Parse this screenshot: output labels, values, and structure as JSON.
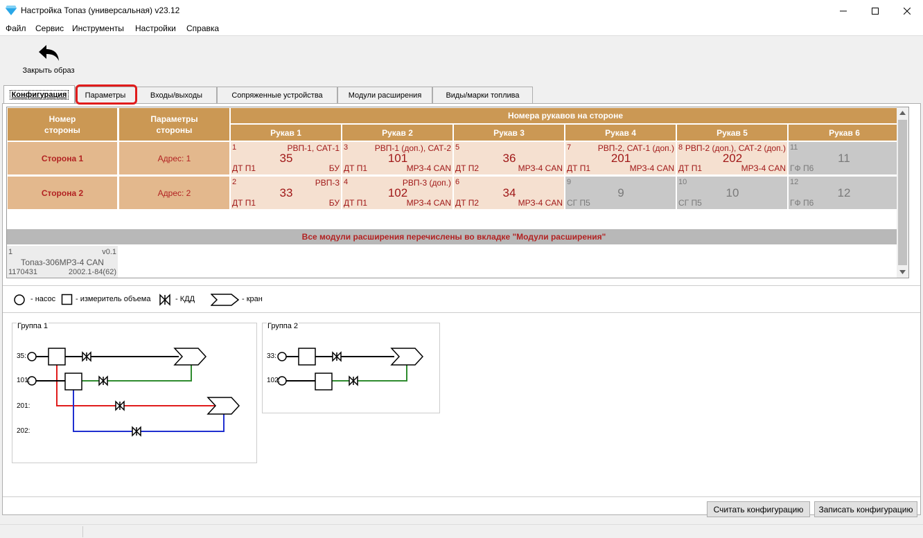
{
  "window": {
    "title": "Настройка Топаз (универсальная) v23.12"
  },
  "menu": [
    "Файл",
    "Сервис",
    "Инструменты",
    "Настройки",
    "Справка"
  ],
  "toolbar": {
    "close_image_label": "Закрыть образ"
  },
  "tabs": [
    "Конфигурация",
    "Параметры",
    "Входы/выходы",
    "Сопряженные устройства",
    "Модули расширения",
    "Виды/марки топлива"
  ],
  "table": {
    "col_side_number": "Номер\nстороны",
    "col_side_params": "Параметры\nстороны",
    "nozzles_header": "Номера рукавов на стороне",
    "nozzle_headers": [
      "Рукав 1",
      "Рукав 2",
      "Рукав 3",
      "Рукав 4",
      "Рукав 5",
      "Рукав 6"
    ],
    "rows": [
      {
        "side": "Сторона 1",
        "address": "Адрес: 1",
        "nozzles": [
          {
            "num": "1",
            "meta": "РВП-1, САТ-1",
            "value": "35",
            "fuel": "ДТ П1",
            "device": "БУ",
            "active": true
          },
          {
            "num": "3",
            "meta": "РВП-1 (доп.), САТ-2",
            "value": "101",
            "fuel": "ДТ П1",
            "device": "МРЗ-4 CAN",
            "active": true
          },
          {
            "num": "5",
            "meta": "",
            "value": "36",
            "fuel": "ДТ П2",
            "device": "МРЗ-4 CAN",
            "active": true
          },
          {
            "num": "7",
            "meta": "РВП-2, САТ-1 (доп.)",
            "value": "201",
            "fuel": "ДТ П1",
            "device": "МРЗ-4 CAN",
            "active": true
          },
          {
            "num": "8",
            "meta": "РВП-2 (доп.), САТ-2 (доп.)",
            "value": "202",
            "fuel": "ДТ П1",
            "device": "МРЗ-4 CAN",
            "active": true
          },
          {
            "num": "11",
            "meta": "",
            "value": "11",
            "fuel": "ГФ П6",
            "device": "",
            "active": false
          }
        ]
      },
      {
        "side": "Сторона 2",
        "address": "Адрес: 2",
        "nozzles": [
          {
            "num": "2",
            "meta": "РВП-3",
            "value": "33",
            "fuel": "ДТ П1",
            "device": "БУ",
            "active": true
          },
          {
            "num": "4",
            "meta": "РВП-3 (доп.)",
            "value": "102",
            "fuel": "ДТ П1",
            "device": "МРЗ-4 CAN",
            "active": true
          },
          {
            "num": "6",
            "meta": "",
            "value": "34",
            "fuel": "ДТ П2",
            "device": "МРЗ-4 CAN",
            "active": true
          },
          {
            "num": "9",
            "meta": "",
            "value": "9",
            "fuel": "СГ П5",
            "device": "",
            "active": false
          },
          {
            "num": "10",
            "meta": "",
            "value": "10",
            "fuel": "СГ П5",
            "device": "",
            "active": false
          },
          {
            "num": "12",
            "meta": "",
            "value": "12",
            "fuel": "ГФ П6",
            "device": "",
            "active": false
          }
        ]
      }
    ]
  },
  "info_bar": "Все модули расширения перечислены во вкладке \"Модули расширения\"",
  "module": {
    "num": "1",
    "version": "v0.1",
    "name": "Топаз-306МРЗ-4 CAN",
    "serial": "1170431",
    "build": "2002.1-84(62)"
  },
  "legend": {
    "pump": "- насос",
    "meter": "- измеритель объема",
    "valve": "- КДД",
    "tap": "- кран"
  },
  "groups": [
    {
      "title": "Группа 1",
      "labels": [
        "35:",
        "101:",
        "201:",
        "202:"
      ]
    },
    {
      "title": "Группа 2",
      "labels": [
        "33:",
        "102:"
      ]
    }
  ],
  "buttons": {
    "read_config": "Считать конфигурацию",
    "write_config": "Записать конфигурацию"
  },
  "colors": {
    "header": "#cb9854",
    "side_cell": "#e3b88d",
    "nozzle_active": "#f5e0d0",
    "nozzle_inactive": "#c8c8c8",
    "text_red": "#b22222",
    "line_red": "#e01b1b",
    "line_green": "#2e8b2e",
    "line_blue": "#1f2fd0"
  }
}
